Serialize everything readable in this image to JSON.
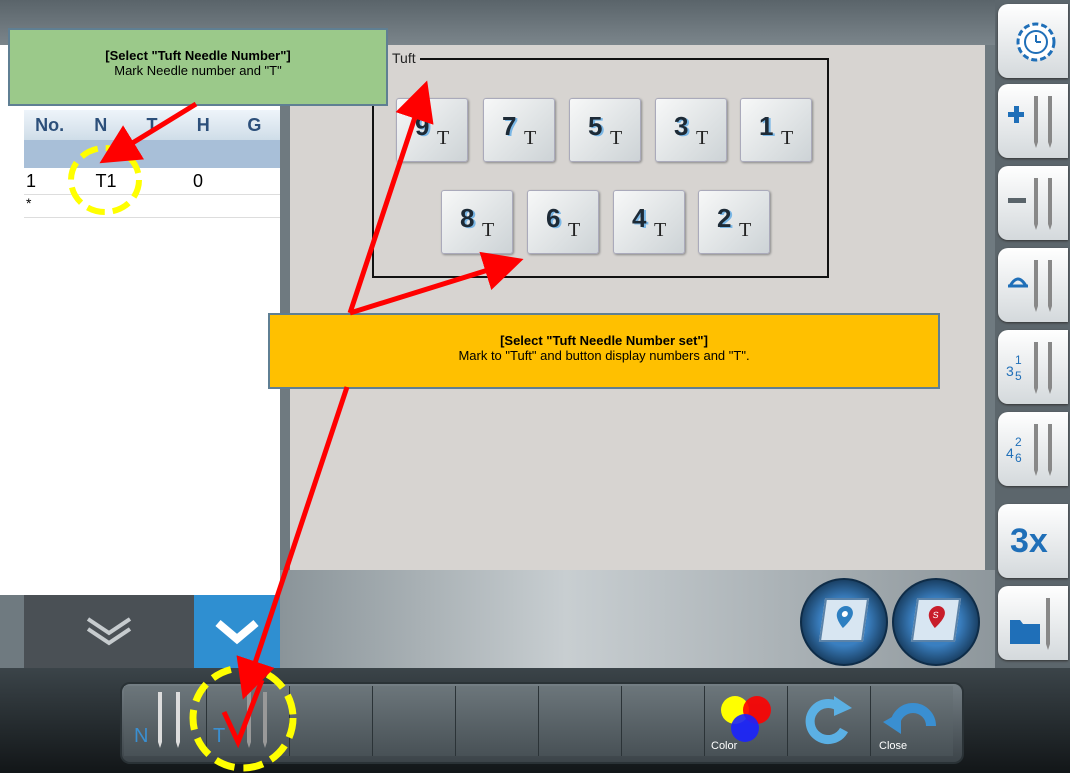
{
  "list": {
    "headers": [
      "No.",
      "N",
      "T",
      "H",
      "G"
    ],
    "rows": [
      {
        "no": "1",
        "n": "T1",
        "t": "",
        "h": "0",
        "g": ""
      },
      {
        "no": "*",
        "n": "",
        "t": "",
        "h": "",
        "g": ""
      }
    ]
  },
  "tuft": {
    "label": "Tuft",
    "row1": [
      {
        "num": "9",
        "t": "T"
      },
      {
        "num": "7",
        "t": "T"
      },
      {
        "num": "5",
        "t": "T"
      },
      {
        "num": "3",
        "t": "T"
      },
      {
        "num": "1",
        "t": "T"
      }
    ],
    "row2": [
      {
        "num": "8",
        "t": "T"
      },
      {
        "num": "6",
        "t": "T"
      },
      {
        "num": "4",
        "t": "T"
      },
      {
        "num": "2",
        "t": "T"
      }
    ]
  },
  "right_toolbar": {
    "btn3x_label": "3x",
    "icons": [
      "timer-icon",
      "add-needle-icon",
      "remove-needle-icon",
      "loop-needle-icon",
      "odd-needles-icon",
      "even-needles-icon",
      "3x-icon",
      "folder-needle-icon"
    ]
  },
  "bottom_bar": {
    "n_label": "N",
    "t_label": "T",
    "color_label": "Color",
    "close_label": "Close"
  },
  "callouts": {
    "needle_title": "[Select \"Tuft Needle Number\"]",
    "needle_text": "Mark Needle number and \"T\"",
    "set_title": "[Select \"Tuft Needle Number set\"]",
    "set_text": "Mark to \"Tuft\" and button display numbers and \"T\"."
  },
  "colors": {
    "accent": "#2f8fd1",
    "annotation_red": "#ff0000",
    "highlight_yellow": "#ffff00",
    "callout_green": "#9bc98a",
    "callout_orange": "#ffc000"
  }
}
